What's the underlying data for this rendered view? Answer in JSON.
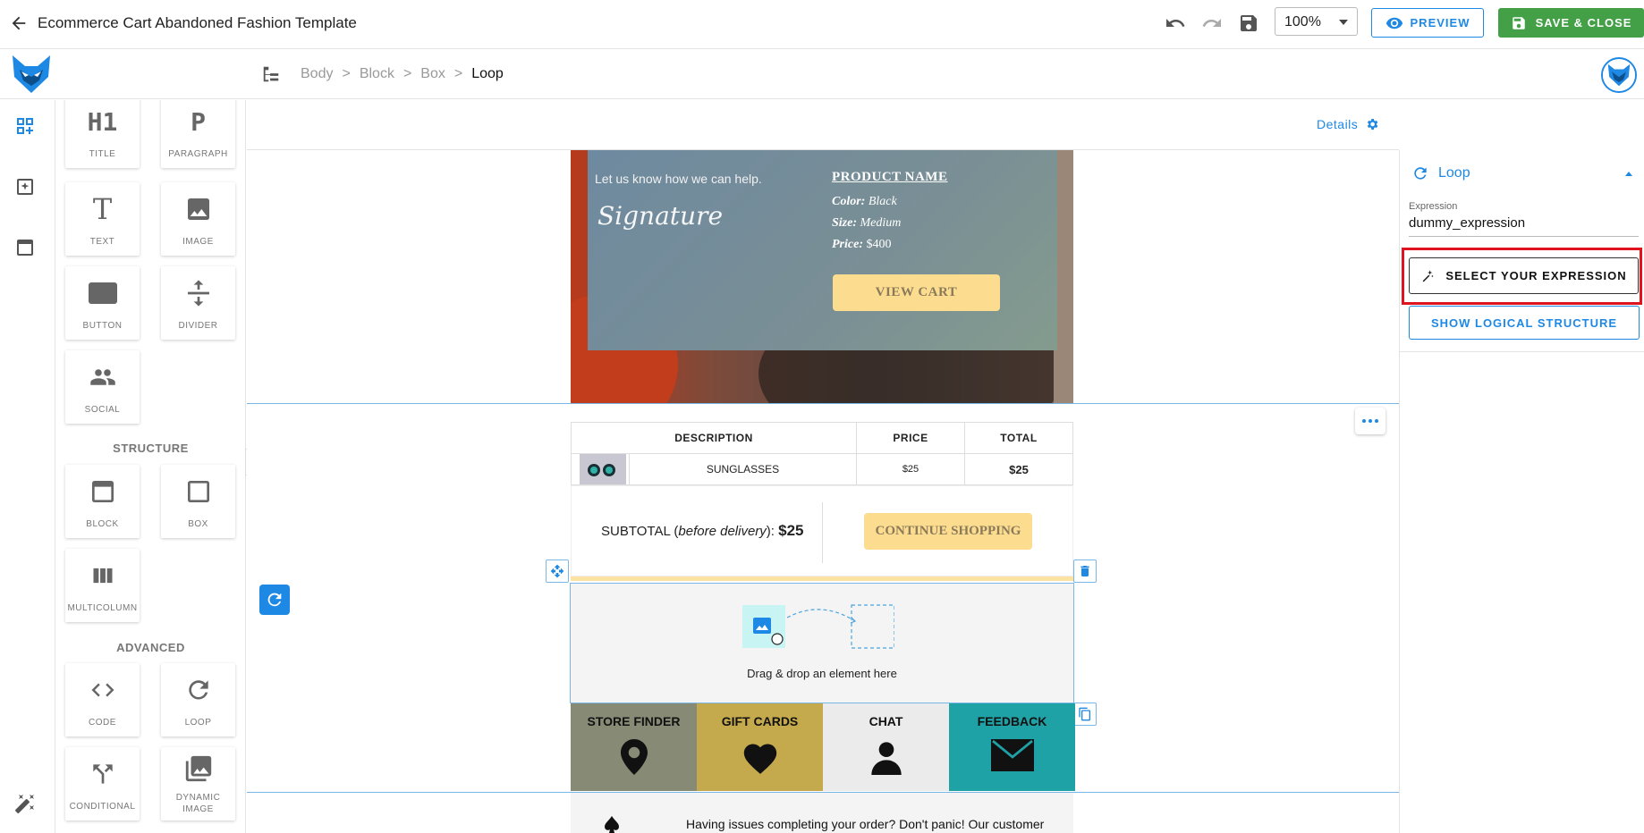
{
  "header": {
    "title": "Ecommerce Cart Abandoned Fashion Template",
    "zoom": "100%",
    "preview_label": "PREVIEW",
    "save_label": "SAVE & CLOSE"
  },
  "breadcrumb": {
    "items": [
      "Body",
      "Block",
      "Box"
    ],
    "separator": ">",
    "current": "Loop"
  },
  "blocks": {
    "tiles": {
      "title": "TITLE",
      "paragraph": "PARAGRAPH",
      "text": "TEXT",
      "image": "IMAGE",
      "button": "BUTTON",
      "divider": "DIVIDER",
      "social": "SOCIAL",
      "block": "BLOCK",
      "box": "BOX",
      "multicolumn": "MULTICOLUMN",
      "code": "CODE",
      "loop": "LOOP",
      "conditional": "CONDITIONAL",
      "dynamic_image": "DYNAMIC IMAGE"
    },
    "glyphs": {
      "title": "H1",
      "paragraph": "P",
      "text": "T"
    },
    "sections": {
      "structure": "STRUCTURE",
      "advanced": "ADVANCED"
    }
  },
  "canvas": {
    "details_label": "Details",
    "hero": {
      "help": "Let us know how we can help.",
      "signature": "Signature",
      "product_name": "PRODUCT NAME",
      "color_label": "Color:",
      "color_value": "Black",
      "size_label": "Size:",
      "size_value": "Medium",
      "price_label": "Price:",
      "price_value": "$400",
      "cta": "VIEW CART"
    },
    "table": {
      "headers": [
        "DESCRIPTION",
        "PRICE",
        "TOTAL"
      ],
      "row": {
        "name": "SUNGLASSES",
        "price": "$25",
        "total": "$25"
      }
    },
    "subtotal": {
      "prefix": "SUBTOTAL (",
      "note": "before delivery",
      "suffix": "):",
      "amount": "$25"
    },
    "continue_label": "CONTINUE SHOPPING",
    "drop_text": "Drag & drop an element here",
    "footer": [
      {
        "label": "STORE FINDER",
        "bg": "#878a75"
      },
      {
        "label": "GIFT CARDS",
        "bg": "#c4aa4c"
      },
      {
        "label": "CHAT",
        "bg": "#ebebeb"
      },
      {
        "label": "FEEDBACK",
        "bg": "#1fa2a6"
      }
    ],
    "issues_text": "Having issues completing your order? Don't panic! Our customer"
  },
  "right_panel": {
    "section_title": "Loop",
    "expression_label": "Expression",
    "expression_value": "dummy_expression",
    "select_label": "SELECT YOUR EXPRESSION",
    "show_label": "SHOW LOGICAL STRUCTURE"
  },
  "colors": {
    "accent": "#1e88e5",
    "save": "#43a047",
    "highlight": "#e0141e",
    "cta": "#fcdc8f"
  }
}
